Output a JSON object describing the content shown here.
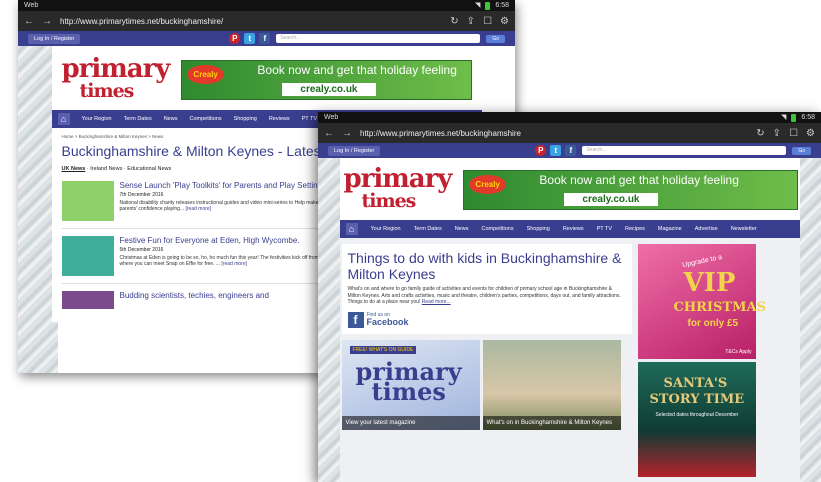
{
  "status": {
    "app": "Web",
    "time": "6:58"
  },
  "browser": {
    "url": "http://www.primarytimes.net/buckinghamshire/",
    "url_front": "http://www.primarytimes.net/buckinghamshire"
  },
  "site": {
    "login": "Log In / Register",
    "search_placeholder": "Search...",
    "go": "Go",
    "logo_top": "primary",
    "logo_bottom": "times",
    "banner": {
      "badge": "Crealy",
      "tagline": "Book now and get that holiday feeling",
      "url": "crealy.co.uk"
    }
  },
  "nav_back": [
    "Your Region",
    "Term Dates",
    "News",
    "Competitions",
    "Shopping",
    "Reviews",
    "PT TV"
  ],
  "nav_front": [
    "Your Region",
    "Term Dates",
    "News",
    "Competitions",
    "Shopping",
    "Reviews",
    "PT TV",
    "Recipes",
    "Magazine",
    "Advertise",
    "Newsletter"
  ],
  "news": {
    "breadcrumb": "Home > Buckinghamshire & Milton Keynes > News",
    "title": "Buckinghamshire & Milton Keynes - Latest News",
    "filters": [
      "UK News",
      "Ireland News",
      "Educational News"
    ],
    "articles": [
      {
        "title": "Sense Launch 'Play Toolkits' for Parents and Play Settings",
        "date": "7th December 2016",
        "text": "National disability charity releases instructional guides and video mini-series to Help make play settings accessible for children with multiple needs Increase parents' confidence playing...",
        "more": "[read more]",
        "color": "#8fcf6a"
      },
      {
        "title": "Festive Fun for Everyone at Eden, High Wycombe.",
        "date": "5th December 2016",
        "text": "Christmas at Eden is going to be so, ho, ho much fun this year! The festivities kick off from 5th December with the arrival of Eden's unique interactive pod where you can meet Snap on Effie for free. ...",
        "more": "[read more]",
        "color": "#3fae9a"
      },
      {
        "title": "Budding scientists, techies, engineers and",
        "date": "",
        "text": "",
        "more": "",
        "color": "#7a4a8a"
      }
    ]
  },
  "feature": {
    "title": "Things to do with kids in Buckinghamshire & Milton Keynes",
    "desc": "What's on and where to go family guide of activities and events for children of primary school age in Buckinghamshire & Milton Keynes. Arts and crafts activities, music and theatre, children's parties, competitions, days out, and family attractions. Things to do at a place near you!",
    "more": "Read more...",
    "fb_small": "Find us on",
    "fb_big": "Facebook",
    "tiles": [
      {
        "caption": "View your latest magazine",
        "badge": "FREE! WHAT'S ON GUIDE"
      },
      {
        "caption": "What's on in Buckinghamshire & Milton Keynes"
      }
    ]
  },
  "ads": [
    {
      "line1": "Upgrade to a",
      "line2": "VIP",
      "line3": "CHRISTMAS",
      "line4": "for only £5",
      "note": "T&Cs Apply"
    },
    {
      "line1": "SANTA'S",
      "line2": "STORY TIME",
      "line3": "Selected dates throughout December"
    }
  ],
  "colors": {
    "brand": "#3a3e8f",
    "logo_red": "#c0202f"
  }
}
